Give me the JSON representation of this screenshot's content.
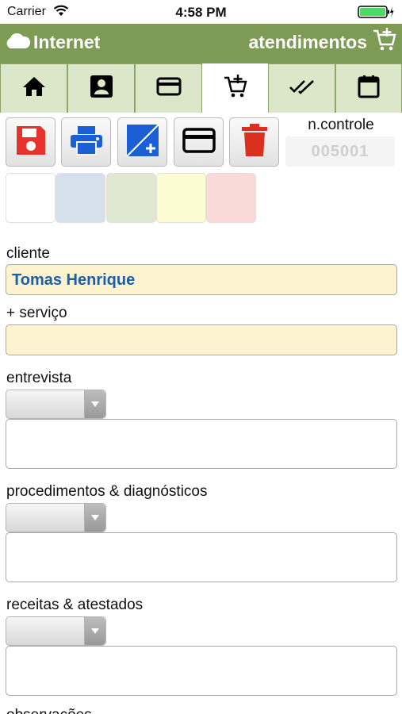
{
  "status_bar": {
    "carrier": "Carrier",
    "time": "4:58 PM"
  },
  "header": {
    "connection_label": "Internet",
    "screen_title": "atendimentos"
  },
  "tabs": [
    {
      "icon": "home-icon"
    },
    {
      "icon": "contact-card-icon"
    },
    {
      "icon": "credit-card-icon"
    },
    {
      "icon": "cart-add-icon",
      "active": true
    },
    {
      "icon": "double-check-icon"
    },
    {
      "icon": "calendar-icon"
    }
  ],
  "toolbar": {
    "buttons": [
      "save-icon",
      "print-icon",
      "edit-add-icon",
      "credit-card-icon",
      "trash-icon"
    ],
    "control_label": "n.controle",
    "control_value": "005001"
  },
  "color_swatches": [
    "#ffffff",
    "#d6dfec",
    "#e1e8d1",
    "#fdfbd2",
    "#fbd9d9"
  ],
  "form": {
    "client_label": "cliente",
    "client_value": "Tomas Henrique",
    "service_label": "+ serviço",
    "service_value": "",
    "interview_label": "entrevista",
    "procedures_label": "procedimentos & diagnósticos",
    "prescriptions_label": "receitas & atestados",
    "next_label": "observações"
  },
  "colors": {
    "header_green": "#7d9b55",
    "tab_green": "#dce6c8",
    "field_yellow": "#fdf3cf",
    "client_blue": "#1a5fad",
    "save_red": "#e8332c",
    "print_blue": "#1a5fd6",
    "trash_red": "#d9301f"
  }
}
